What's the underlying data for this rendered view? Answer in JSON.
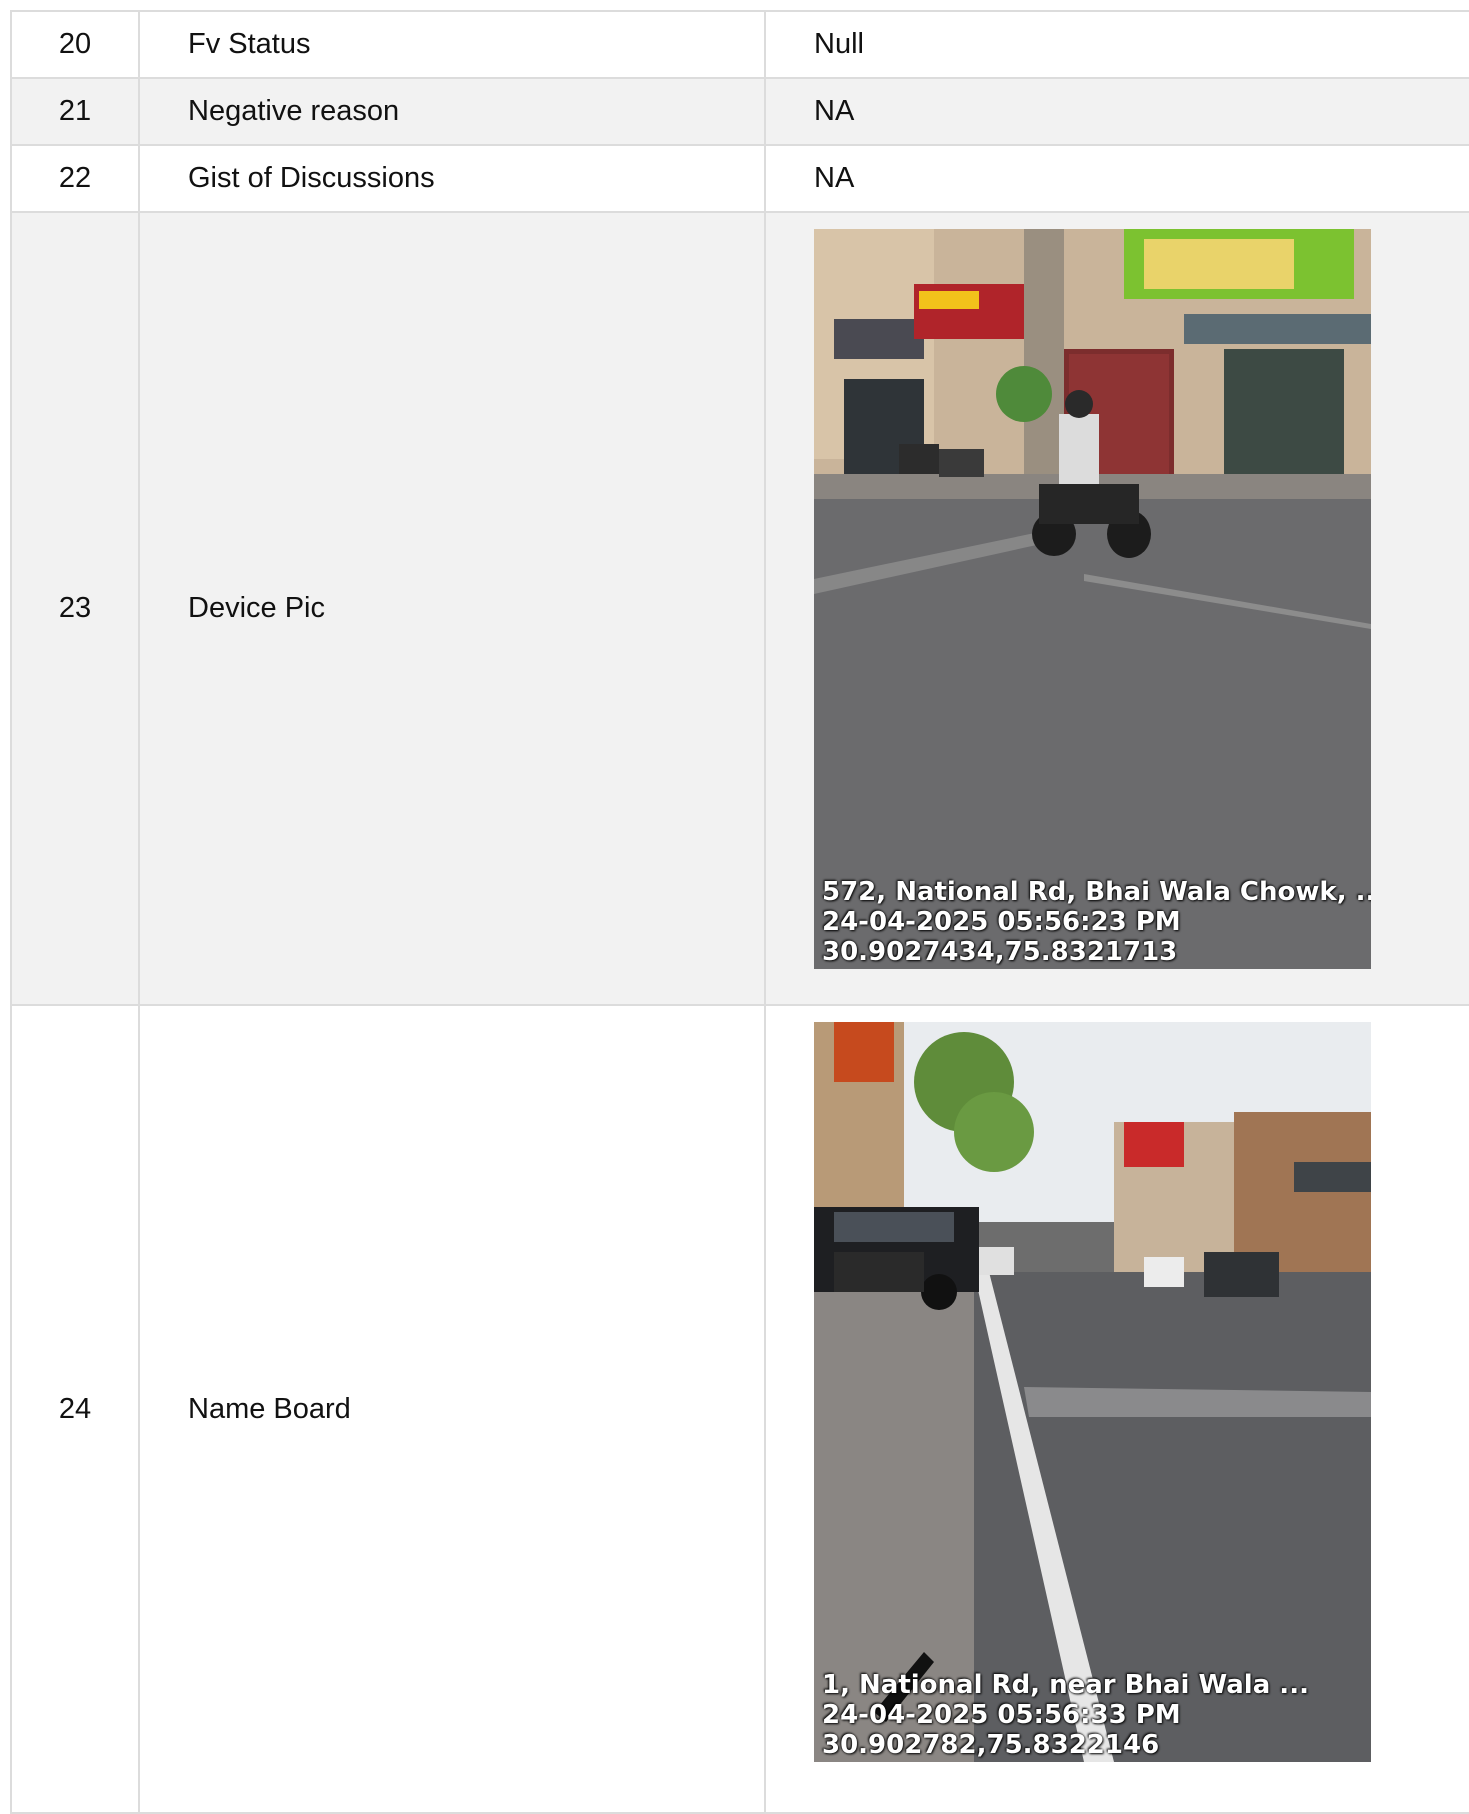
{
  "rows": [
    {
      "no": "20",
      "label": "Fv Status",
      "value": "Null"
    },
    {
      "no": "21",
      "label": "Negative reason",
      "value": "NA"
    },
    {
      "no": "22",
      "label": "Gist of Discussions",
      "value": "NA"
    },
    {
      "no": "23",
      "label": "Device Pic",
      "photo": {
        "address": "572, National Rd, Bhai Wala Chowk, ...",
        "datetime": "24-04-2025 05:56:23 PM",
        "coords": "30.9027434,75.8321713"
      }
    },
    {
      "no": "24",
      "label": "Name Board",
      "photo": {
        "address": "1, National Rd, near Bhai Wala ...",
        "datetime": "24-04-2025 05:56:33 PM",
        "coords": "30.902782,75.8322146"
      }
    }
  ]
}
